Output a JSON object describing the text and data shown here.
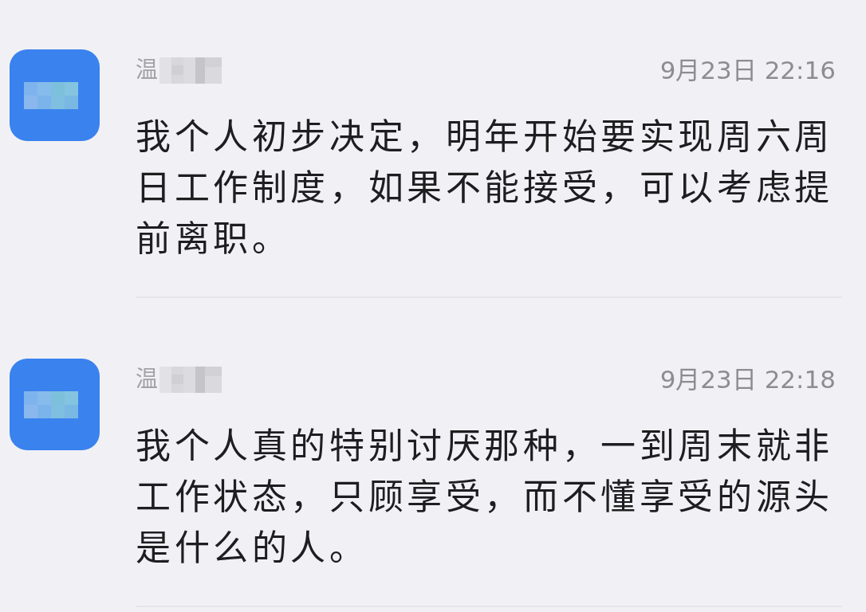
{
  "messages": [
    {
      "sender": "温",
      "time": "9月23日 22:16",
      "text": "我个人初步决定，明年开始要实现周六周日工作制度，如果不能接受，可以考虑提前离职。"
    },
    {
      "sender": "温",
      "time": "9月23日 22:18",
      "text": "我个人真的特别讨厌那种，一到周末就非工作状态，只顾享受，而不懂享受的源头是什么的人。"
    }
  ]
}
